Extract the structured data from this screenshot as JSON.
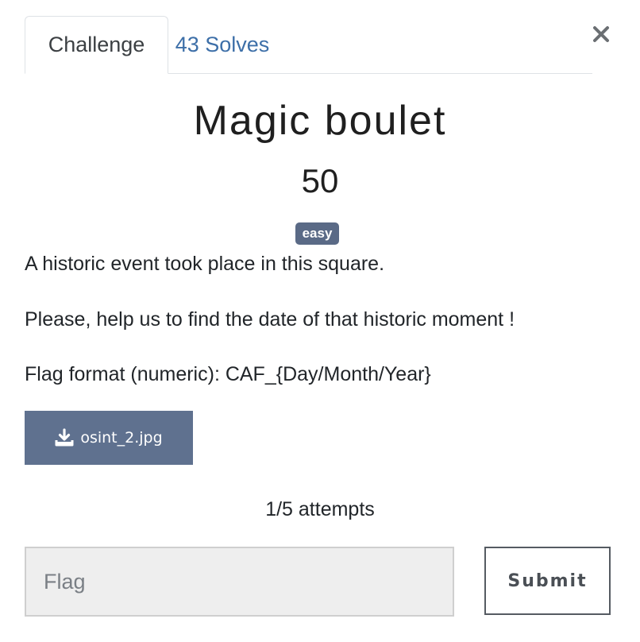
{
  "tabs": [
    {
      "label": "Challenge",
      "active": true
    },
    {
      "label": "43 Solves",
      "active": false
    }
  ],
  "challenge": {
    "name": "Magic boulet",
    "points": "50",
    "difficulty": "easy",
    "description": [
      "A historic event took place in this square.",
      "Please, help us to find the date of that historic moment !",
      "Flag format (numeric): CAF_{Day/Month/Year}"
    ],
    "file": {
      "label": "osint_2.jpg",
      "icon": "download-icon"
    },
    "attempts": "1/5 attempts"
  },
  "form": {
    "flag_placeholder": "Flag",
    "flag_value": "",
    "submit_label": "Submit"
  },
  "colors": {
    "tab_link": "#3d6fa8",
    "badge": "#5a6a86",
    "download_button": "#5f718f",
    "input_background": "#eeeeee"
  },
  "icons": {
    "close": "close-icon",
    "download": "download-icon"
  }
}
